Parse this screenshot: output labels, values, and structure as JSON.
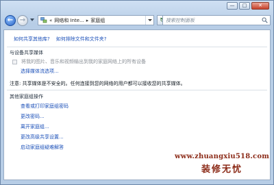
{
  "window": {
    "controls": {
      "minimize": "—",
      "maximize": "□",
      "close": "✕"
    }
  },
  "nav": {
    "back_icon": "back-arrow-icon",
    "forward_icon": "forward-arrow-icon",
    "address": {
      "prefix": "«",
      "crumbs": [
        "网络和 Inte...",
        "家庭组"
      ],
      "separator": "▸"
    },
    "search_placeholder": "搜索控制面板"
  },
  "top_links": [
    "如何共享其他库?",
    "如何排除文件和文件夹?"
  ],
  "media": {
    "section_title": "与设备共享媒体",
    "checkbox_label": "将我的图片、音乐和视频输出到我的家庭网络上的所有设备",
    "checkbox_checked": false,
    "options_link": "选择媒体流选项...",
    "note": "注意: 共享媒体是不安全的。任何连接到您的网络的用户都可以接收您的共享媒体。"
  },
  "other_actions": {
    "section_title": "其他家庭组操作",
    "links": [
      "查看或打印家庭组密码",
      "更改密码...",
      "离开家庭组...",
      "更改高级共享设置...",
      "启动家庭组疑难解答"
    ]
  },
  "watermark": {
    "url": "www.zhuangxiu518.com",
    "brand": "装修无忧"
  },
  "colors": {
    "link": "#1a4fb8",
    "watermark": "#8b2a17"
  }
}
